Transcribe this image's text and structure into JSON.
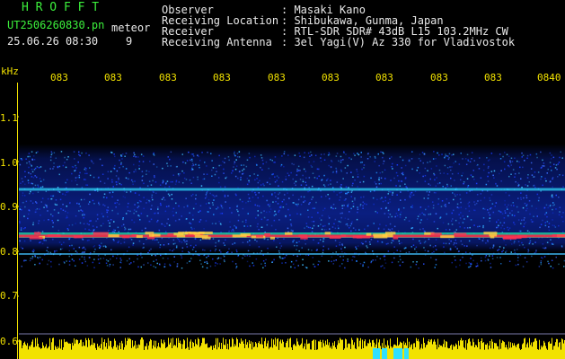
{
  "header": {
    "brand": "H R O F F T",
    "filename": "UT2506260830.pn",
    "meteor_word": "meteor",
    "date_time": "25.06.26 08:30",
    "count": "9",
    "info_labels": [
      "Observer",
      "Receiving Location",
      "Receiver",
      "Receiving Antenna"
    ],
    "info_values": [
      ": Masaki Kano",
      ": Shibukawa, Gunma, Japan",
      ": RTL-SDR SDR# 43dB L15 103.2MHz CW",
      ": 3el Yagi(V) Az 330 for Vladivostok"
    ]
  },
  "axis": {
    "unit": "kHz",
    "y_ticks": [
      "1.1",
      "1.0",
      "0.9",
      "0.8",
      "0.7",
      "0.6"
    ],
    "x_ticks": [
      "083",
      "083",
      "083",
      "083",
      "083",
      "083",
      "083",
      "083",
      "083",
      "0840"
    ]
  },
  "colors": {
    "text_green": "#3cf03c",
    "text_white": "#e8e8e8",
    "axis_yellow": "#f2e200",
    "noise_blue": "#1a3cff",
    "echo_red": "#ff2040"
  }
}
